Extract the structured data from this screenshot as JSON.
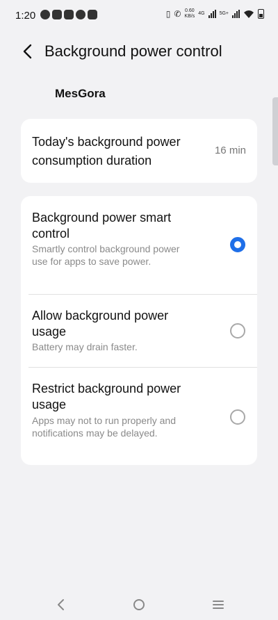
{
  "status_bar": {
    "time": "1:20",
    "net_speed_value": "0.60",
    "net_speed_unit": "KB/s",
    "network_4g": "4G",
    "network_5g": "5G+"
  },
  "header": {
    "title": "Background power control"
  },
  "app": {
    "name": "MesGora"
  },
  "duration_card": {
    "label": "Today's background power consumption duration",
    "value": "16 min"
  },
  "options": [
    {
      "title": "Background power smart control",
      "description": "Smartly control background power use for apps to save power.",
      "selected": true
    },
    {
      "title": "Allow background power usage",
      "description": "Battery may drain faster.",
      "selected": false
    },
    {
      "title": "Restrict background power usage",
      "description": "Apps may not to run properly and notifications may be delayed.",
      "selected": false
    }
  ],
  "colors": {
    "accent": "#1f6fe8",
    "background": "#f2f2f4",
    "card": "#ffffff"
  }
}
